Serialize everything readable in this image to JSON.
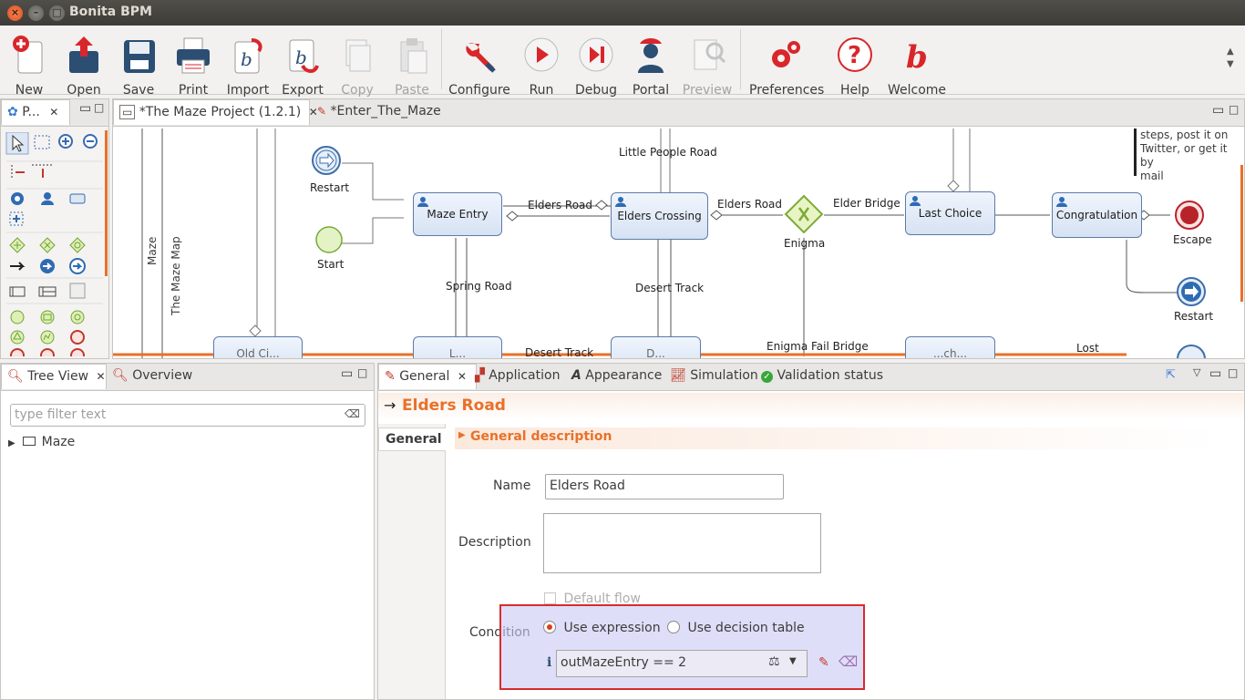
{
  "window": {
    "title": "Bonita BPM"
  },
  "toolbar": {
    "items": [
      {
        "label": "New"
      },
      {
        "label": "Open"
      },
      {
        "label": "Save"
      },
      {
        "label": "Print"
      },
      {
        "label": "Import"
      },
      {
        "label": "Export"
      },
      {
        "label": "Copy"
      },
      {
        "label": "Paste"
      },
      {
        "label": "Configure"
      },
      {
        "label": "Run"
      },
      {
        "label": "Debug"
      },
      {
        "label": "Portal"
      },
      {
        "label": "Preview"
      },
      {
        "label": "Preferences"
      },
      {
        "label": "Help"
      },
      {
        "label": "Welcome"
      }
    ],
    "accent": "#cc2222"
  },
  "palette": {
    "tab_label": "P..."
  },
  "editor": {
    "tabs": [
      {
        "label": "*The Maze Project (1.2.1)"
      },
      {
        "label": "*Enter_The_Maze"
      }
    ]
  },
  "diagram": {
    "pools": [
      {
        "label": "Maze"
      },
      {
        "label": "The Maze Map"
      }
    ],
    "tasks": {
      "maze_entry": "Maze Entry",
      "elders_crossing": "Elders Crossing",
      "last_choice": "Last Choice",
      "congratulation": "Congratulation"
    },
    "events": {
      "restart_top": "Restart",
      "start": "Start",
      "escape": "Escape",
      "restart_right": "Restart"
    },
    "gateway": "Enigma",
    "flows": {
      "little_people": "Little People Road",
      "elders_road_1": "Elders Road",
      "elders_road_2": "Elders Road",
      "elder_bridge": "Elder Bridge",
      "spring_road": "Spring Road",
      "desert_track": "Desert Track",
      "desert_track_2": "Desert Track",
      "enigma_fail": "Enigma Fail Bridge",
      "lost": "Lost"
    },
    "annotation": [
      "steps, post it on",
      "Twitter, or get it by",
      "mail"
    ],
    "partial_tasks": [
      "Old Ci...",
      "L...",
      "D...",
      "...ch..."
    ]
  },
  "tree": {
    "tabs": [
      {
        "label": "Tree View"
      },
      {
        "label": "Overview"
      }
    ],
    "filter_placeholder": "type filter text",
    "items": [
      {
        "label": "Maze"
      }
    ]
  },
  "properties": {
    "tabs": [
      {
        "label": "General"
      },
      {
        "label": "Application"
      },
      {
        "label": "Appearance"
      },
      {
        "label": "Simulation"
      },
      {
        "label": "Validation status"
      }
    ],
    "title": "Elders Road",
    "side_tab": "General",
    "section": "General description",
    "name_label": "Name",
    "name_value": "Elders Road",
    "description_label": "Description",
    "description_value": "",
    "default_flow_label": "Default flow",
    "condition_label": "Condition",
    "use_expression": "Use expression",
    "use_decision_table": "Use decision table",
    "expression_value": "outMazeEntry == 2",
    "info_marker": "i",
    "title_color": "#e8712a",
    "highlight_color": "#d62c2c"
  }
}
